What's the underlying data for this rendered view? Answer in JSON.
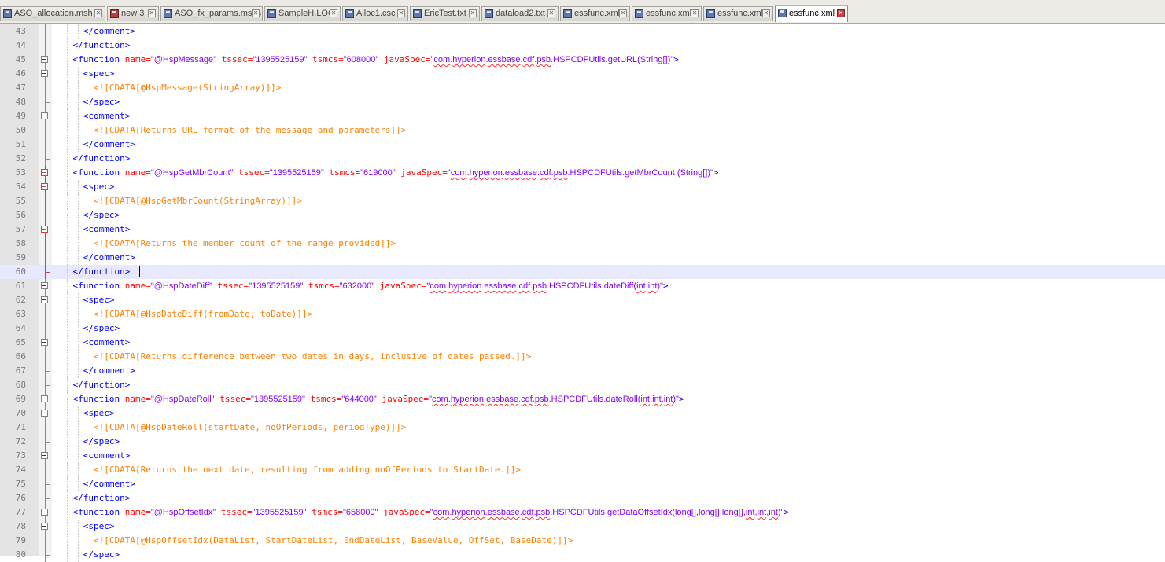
{
  "tabs": [
    {
      "label": "ASO_allocation.msh",
      "modified": false,
      "active": false,
      "width": 134
    },
    {
      "label": "new  3",
      "modified": true,
      "active": false,
      "width": 66
    },
    {
      "label": "ASO_fx_params.mshs",
      "modified": false,
      "active": false,
      "width": 130
    },
    {
      "label": "SampleH.LOG",
      "modified": false,
      "active": false,
      "width": 97
    },
    {
      "label": "Alloc1.csc",
      "modified": false,
      "active": false,
      "width": 84
    },
    {
      "label": "EricTest.txt",
      "modified": false,
      "active": false,
      "width": 89
    },
    {
      "label": "dataload2.txt",
      "modified": false,
      "active": false,
      "width": 98
    },
    {
      "label": "essfunc.xml",
      "modified": false,
      "active": false,
      "width": 89
    },
    {
      "label": "essfunc.xml",
      "modified": false,
      "active": false,
      "width": 89
    },
    {
      "label": "essfunc.xml",
      "modified": false,
      "active": false,
      "width": 89
    },
    {
      "label": "essfunc.xml",
      "modified": false,
      "active": true,
      "width": 93
    }
  ],
  "editor": {
    "current_line": 60,
    "lines": [
      {
        "n": "43",
        "fold": "line",
        "parts": [
          [
            "",
            "      "
          ],
          [
            "tag",
            "</comment>"
          ]
        ]
      },
      {
        "n": "44",
        "fold": "end",
        "parts": [
          [
            "",
            "    "
          ],
          [
            "tag",
            "</function>"
          ]
        ]
      },
      {
        "n": "45",
        "fold": "box",
        "parts": [
          [
            "",
            "    "
          ],
          [
            "tag",
            "<function "
          ],
          [
            "attr",
            "name="
          ],
          [
            "val",
            "\"@HspMessage\""
          ],
          [
            "attr",
            " tssec="
          ],
          [
            "val",
            "\"1395525159\""
          ],
          [
            "attr",
            " tsmcs="
          ],
          [
            "val",
            "\"608000\""
          ],
          [
            "attr",
            " javaSpec="
          ],
          [
            "val",
            "\"com.hyperion.essbase.cdf.psb.HSPCDFUtils.getURL(String[])\""
          ],
          [
            "tag",
            ">"
          ]
        ]
      },
      {
        "n": "46",
        "fold": "box",
        "parts": [
          [
            "",
            "      "
          ],
          [
            "tag",
            "<spec>"
          ]
        ]
      },
      {
        "n": "47",
        "fold": "line",
        "parts": [
          [
            "",
            "        "
          ],
          [
            "cdata",
            "<![CDATA[@HspMessage(StringArray)]]>"
          ]
        ]
      },
      {
        "n": "48",
        "fold": "end",
        "parts": [
          [
            "",
            "      "
          ],
          [
            "tag",
            "</spec>"
          ]
        ]
      },
      {
        "n": "49",
        "fold": "box",
        "parts": [
          [
            "",
            "      "
          ],
          [
            "tag",
            "<comment>"
          ]
        ]
      },
      {
        "n": "50",
        "fold": "line",
        "parts": [
          [
            "",
            "        "
          ],
          [
            "cdata",
            "<![CDATA[Returns URL format of the message and parameters]]>"
          ]
        ]
      },
      {
        "n": "51",
        "fold": "end",
        "parts": [
          [
            "",
            "      "
          ],
          [
            "tag",
            "</comment>"
          ]
        ]
      },
      {
        "n": "52",
        "fold": "end",
        "parts": [
          [
            "",
            "    "
          ],
          [
            "tag",
            "</function>"
          ]
        ]
      },
      {
        "n": "53",
        "fold": "boxred",
        "parts": [
          [
            "",
            "    "
          ],
          [
            "tag",
            "<function "
          ],
          [
            "attr",
            "name="
          ],
          [
            "val",
            "\"@HspGetMbrCount\""
          ],
          [
            "attr",
            " tssec="
          ],
          [
            "val",
            "\"1395525159\""
          ],
          [
            "attr",
            " tsmcs="
          ],
          [
            "val",
            "\"619000\""
          ],
          [
            "attr",
            " javaSpec="
          ],
          [
            "val",
            "\"com.hyperion.essbase.cdf.psb.HSPCDFUtils.getMbrCount (String[])\""
          ],
          [
            "tag",
            ">"
          ]
        ]
      },
      {
        "n": "54",
        "fold": "boxred",
        "parts": [
          [
            "",
            "      "
          ],
          [
            "tag",
            "<spec>"
          ]
        ]
      },
      {
        "n": "55",
        "fold": "red",
        "parts": [
          [
            "",
            "        "
          ],
          [
            "cdata",
            "<![CDATA[@HspGetMbrCount(StringArray)]]>"
          ]
        ]
      },
      {
        "n": "56",
        "fold": "red",
        "parts": [
          [
            "",
            "      "
          ],
          [
            "tag",
            "</spec>"
          ]
        ]
      },
      {
        "n": "57",
        "fold": "boxred",
        "parts": [
          [
            "",
            "      "
          ],
          [
            "tag",
            "<comment>"
          ]
        ]
      },
      {
        "n": "58",
        "fold": "red",
        "parts": [
          [
            "",
            "        "
          ],
          [
            "cdata",
            "<![CDATA[Returns the member count of the range provided]]>"
          ]
        ]
      },
      {
        "n": "59",
        "fold": "red",
        "parts": [
          [
            "",
            "      "
          ],
          [
            "tag",
            "</comment>"
          ]
        ]
      },
      {
        "n": "60",
        "fold": "endred",
        "parts": [
          [
            "",
            "    "
          ],
          [
            "tag",
            "</function>"
          ]
        ]
      },
      {
        "n": "61",
        "fold": "box",
        "parts": [
          [
            "",
            "    "
          ],
          [
            "tag",
            "<function "
          ],
          [
            "attr",
            "name="
          ],
          [
            "val",
            "\"@HspDateDiff\""
          ],
          [
            "attr",
            " tssec="
          ],
          [
            "val",
            "\"1395525159\""
          ],
          [
            "attr",
            " tsmcs="
          ],
          [
            "val",
            "\"632000\""
          ],
          [
            "attr",
            " javaSpec="
          ],
          [
            "val",
            "\"com.hyperion.essbase.cdf.psb.HSPCDFUtils.dateDiff(int,int)\""
          ],
          [
            "tag",
            ">"
          ]
        ]
      },
      {
        "n": "62",
        "fold": "box",
        "parts": [
          [
            "",
            "      "
          ],
          [
            "tag",
            "<spec>"
          ]
        ]
      },
      {
        "n": "63",
        "fold": "line",
        "parts": [
          [
            "",
            "        "
          ],
          [
            "cdata",
            "<![CDATA[@HspDateDiff(fromDate, toDate)]]>"
          ]
        ]
      },
      {
        "n": "64",
        "fold": "end",
        "parts": [
          [
            "",
            "      "
          ],
          [
            "tag",
            "</spec>"
          ]
        ]
      },
      {
        "n": "65",
        "fold": "box",
        "parts": [
          [
            "",
            "      "
          ],
          [
            "tag",
            "<comment>"
          ]
        ]
      },
      {
        "n": "66",
        "fold": "line",
        "parts": [
          [
            "",
            "        "
          ],
          [
            "cdata",
            "<![CDATA[Returns difference between two dates in days, inclusive of dates passed.]]>"
          ]
        ]
      },
      {
        "n": "67",
        "fold": "end",
        "parts": [
          [
            "",
            "      "
          ],
          [
            "tag",
            "</comment>"
          ]
        ]
      },
      {
        "n": "68",
        "fold": "end",
        "parts": [
          [
            "",
            "    "
          ],
          [
            "tag",
            "</function>"
          ]
        ]
      },
      {
        "n": "69",
        "fold": "box",
        "parts": [
          [
            "",
            "    "
          ],
          [
            "tag",
            "<function "
          ],
          [
            "attr",
            "name="
          ],
          [
            "val",
            "\"@HspDateRoll\""
          ],
          [
            "attr",
            " tssec="
          ],
          [
            "val",
            "\"1395525159\""
          ],
          [
            "attr",
            " tsmcs="
          ],
          [
            "val",
            "\"644000\""
          ],
          [
            "attr",
            " javaSpec="
          ],
          [
            "val",
            "\"com.hyperion.essbase.cdf.psb.HSPCDFUtils.dateRoll(int,int,int)\""
          ],
          [
            "tag",
            ">"
          ]
        ]
      },
      {
        "n": "70",
        "fold": "box",
        "parts": [
          [
            "",
            "      "
          ],
          [
            "tag",
            "<spec>"
          ]
        ]
      },
      {
        "n": "71",
        "fold": "line",
        "parts": [
          [
            "",
            "        "
          ],
          [
            "cdata",
            "<![CDATA[@HspDateRoll(startDate, noOfPeriods, periodType)]]>"
          ]
        ]
      },
      {
        "n": "72",
        "fold": "end",
        "parts": [
          [
            "",
            "      "
          ],
          [
            "tag",
            "</spec>"
          ]
        ]
      },
      {
        "n": "73",
        "fold": "box",
        "parts": [
          [
            "",
            "      "
          ],
          [
            "tag",
            "<comment>"
          ]
        ]
      },
      {
        "n": "74",
        "fold": "line",
        "parts": [
          [
            "",
            "        "
          ],
          [
            "cdata",
            "<![CDATA[Returns the next date, resulting from adding noOfPeriods to StartDate.]]>"
          ]
        ]
      },
      {
        "n": "75",
        "fold": "end",
        "parts": [
          [
            "",
            "      "
          ],
          [
            "tag",
            "</comment>"
          ]
        ]
      },
      {
        "n": "76",
        "fold": "end",
        "parts": [
          [
            "",
            "    "
          ],
          [
            "tag",
            "</function>"
          ]
        ]
      },
      {
        "n": "77",
        "fold": "box",
        "parts": [
          [
            "",
            "    "
          ],
          [
            "tag",
            "<function "
          ],
          [
            "attr",
            "name="
          ],
          [
            "val",
            "\"@HspOffsetIdx\""
          ],
          [
            "attr",
            " tssec="
          ],
          [
            "val",
            "\"1395525159\""
          ],
          [
            "attr",
            " tsmcs="
          ],
          [
            "val",
            "\"658000\""
          ],
          [
            "attr",
            " javaSpec="
          ],
          [
            "val",
            "\"com.hyperion.essbase.cdf.psb.HSPCDFUtils.getDataOffsetIdx(long[],long[],long[],int,int,int)\""
          ],
          [
            "tag",
            ">"
          ]
        ]
      },
      {
        "n": "78",
        "fold": "box",
        "parts": [
          [
            "",
            "      "
          ],
          [
            "tag",
            "<spec>"
          ]
        ]
      },
      {
        "n": "79",
        "fold": "line",
        "parts": [
          [
            "",
            "        "
          ],
          [
            "cdata",
            "<![CDATA[@HspOffsetIdx(DataList, StartDateList, EndDateList, BaseValue, OffSet, BaseDate)]]>"
          ]
        ]
      },
      {
        "n": "80",
        "fold": "end",
        "parts": [
          [
            "",
            "      "
          ],
          [
            "tag",
            "</spec>"
          ]
        ]
      }
    ]
  }
}
